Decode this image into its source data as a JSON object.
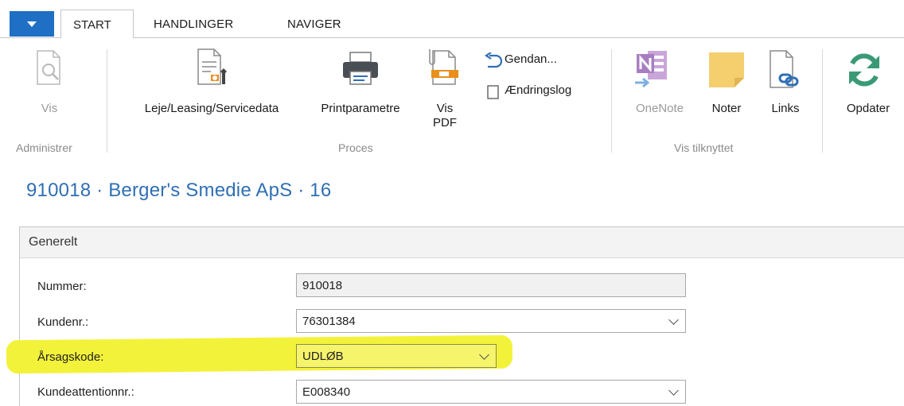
{
  "tabs": [
    "START",
    "HANDLINGER",
    "NAVIGER"
  ],
  "ribbon": {
    "administrer": {
      "label": "Administrer",
      "vis": "Vis"
    },
    "proces": {
      "label": "Proces",
      "leje": "Leje/Leasing/Servicedata",
      "print": "Printparametre",
      "vis_pdf_1": "Vis",
      "vis_pdf_2": "PDF",
      "gendan": "Gendan...",
      "aendringslog": "Ændringslog"
    },
    "tilknyttet": {
      "label": "Vis tilknyttet",
      "onenote": "OneNote",
      "noter": "Noter",
      "links": "Links"
    },
    "opdater": "Opdater"
  },
  "page": {
    "title": "910018 · Berger's Smedie ApS · 16"
  },
  "section": {
    "title": "Generelt",
    "fields": [
      {
        "label": "Nummer:",
        "value": "910018"
      },
      {
        "label": "Kundenr.:",
        "value": "76301384"
      },
      {
        "label": "Årsagskode:",
        "value": "UDLØB"
      },
      {
        "label": "Kundeattentionnr.:",
        "value": "E008340"
      }
    ]
  },
  "colors": {
    "accent": "#1f6fc5",
    "title": "#2f6fb4",
    "highlight": "#f3f23a"
  }
}
